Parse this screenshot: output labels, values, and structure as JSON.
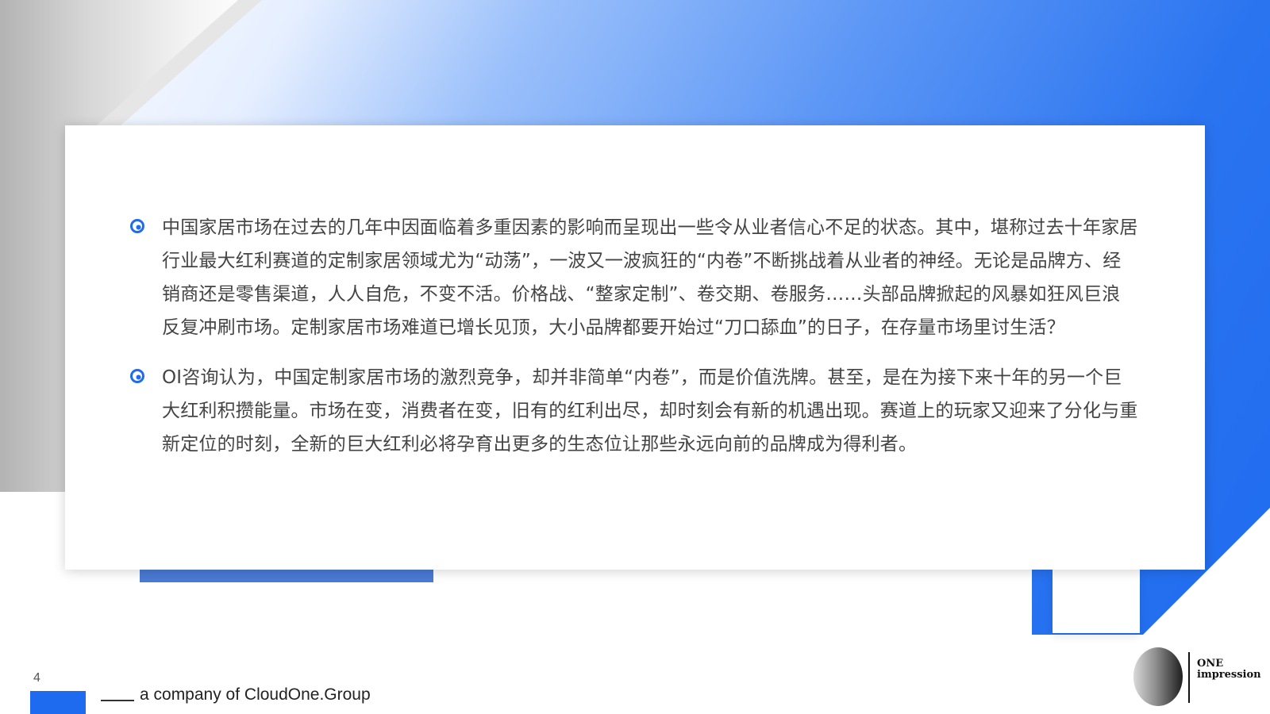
{
  "slide": {
    "paragraphs": [
      "中国家居市场在过去的几年中因面临着多重因素的影响而呈现出一些令从业者信心不足的状态。其中，堪称过去十年家居行业最大红利赛道的定制家居领域尤为“动荡”，一波又一波疯狂的“内卷”不断挑战着从业者的神经。无论是品牌方、经销商还是零售渠道，人人自危，不变不活。价格战、“整家定制”、卷交期、卷服务……头部品牌掀起的风暴如狂风巨浪反复冲刷市场。定制家居市场难道已增长见顶，大小品牌都要开始过“刀口舔血”的日子，在存量市场里讨生活？",
      "OI咨询认为，中国定制家居市场的激烈竞争，却并非简单“内卷”，而是价值洗牌。甚至，是在为接下来十年的另一个巨大红利积攒能量。市场在变，消费者在变，旧有的红利出尽，却时刻会有新的机遇出现。赛道上的玩家又迎来了分化与重新定位的时刻，全新的巨大红利必将孕育出更多的生态位让那些永远向前的品牌成为得利者。"
    ],
    "bullet_icon": "circle-bullet-icon",
    "accent_color": "#1f6bf0"
  },
  "footer": {
    "page_number": "4",
    "company_text": "a company of CloudOne.Group"
  },
  "logo": {
    "line1": "ONE",
    "line2": "impression"
  }
}
